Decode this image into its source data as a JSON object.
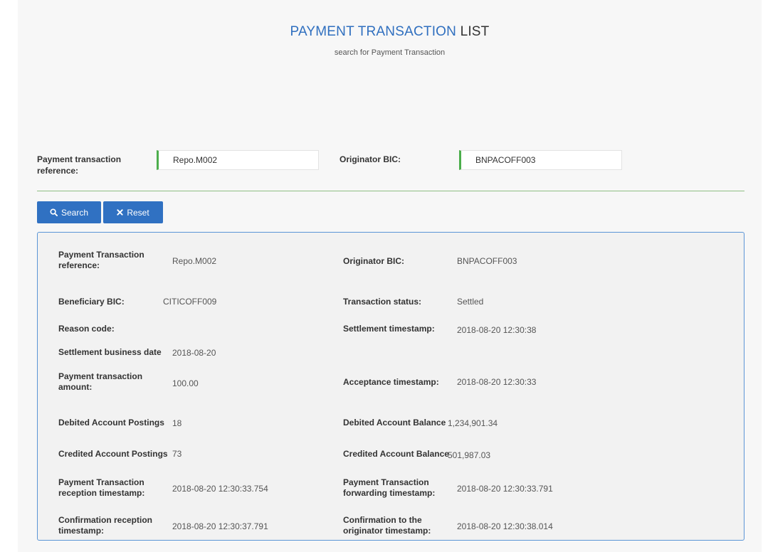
{
  "header": {
    "title_highlight": "PAYMENT TRANSACTION",
    "title_rest": "LIST",
    "subtitle": "search for Payment Transaction"
  },
  "search": {
    "reference_label": "Payment transaction reference:",
    "reference_value": "Repo.M002",
    "originator_label": "Originator BIC:",
    "originator_value": "BNPACOFF003",
    "search_button": "Search",
    "reset_button": "Reset"
  },
  "result": {
    "ref_label": "Payment Transaction reference:",
    "ref_value": "Repo.M002",
    "orig_label": "Originator BIC:",
    "orig_value": "BNPACOFF003",
    "benef_label": "Beneficiary BIC:",
    "benef_value": "CITICOFF009",
    "status_label": "Transaction status:",
    "status_value": "Settled",
    "reason_label": "Reason code:",
    "reason_value": "",
    "settle_ts_label": "Settlement timestamp:",
    "settle_ts_value": "2018-08-20 12:30:38",
    "settle_date_label": "Settlement business date",
    "settle_date_value": "2018-08-20",
    "amount_label": "Payment transaction amount:",
    "amount_value": "100.00",
    "accept_ts_label": "Acceptance timestamp:",
    "accept_ts_value": "2018-08-20 12:30:33",
    "deb_post_label": "Debited Account Postings",
    "deb_post_value": "18",
    "deb_bal_label": "Debited Account Balance",
    "deb_bal_value": "1,234,901.34",
    "cred_post_label": "Credited Account Postings",
    "cred_post_value": "73",
    "cred_bal_label": "Credited Account Balance",
    "cred_bal_value": "501,987.03",
    "recv_ts_label": "Payment Transaction reception timestamp:",
    "recv_ts_value": "2018-08-20 12:30:33.754",
    "fwd_ts_label": "Payment Transaction forwarding timestamp:",
    "fwd_ts_value": "2018-08-20 12:30:33.791",
    "conf_recv_label": "Confirmation reception timestamp:",
    "conf_recv_value": "2018-08-20 12:30:37.791",
    "conf_orig_label": "Confirmation to the originator timestamp:",
    "conf_orig_value": "2018-08-20 12:30:38.014"
  },
  "icons": {
    "search": "search-icon",
    "reset": "close-icon"
  },
  "colors": {
    "primary": "#3071c2",
    "title_blue": "#2f6fbf",
    "input_accent": "#4cae4c",
    "result_border": "#5b95d6"
  }
}
